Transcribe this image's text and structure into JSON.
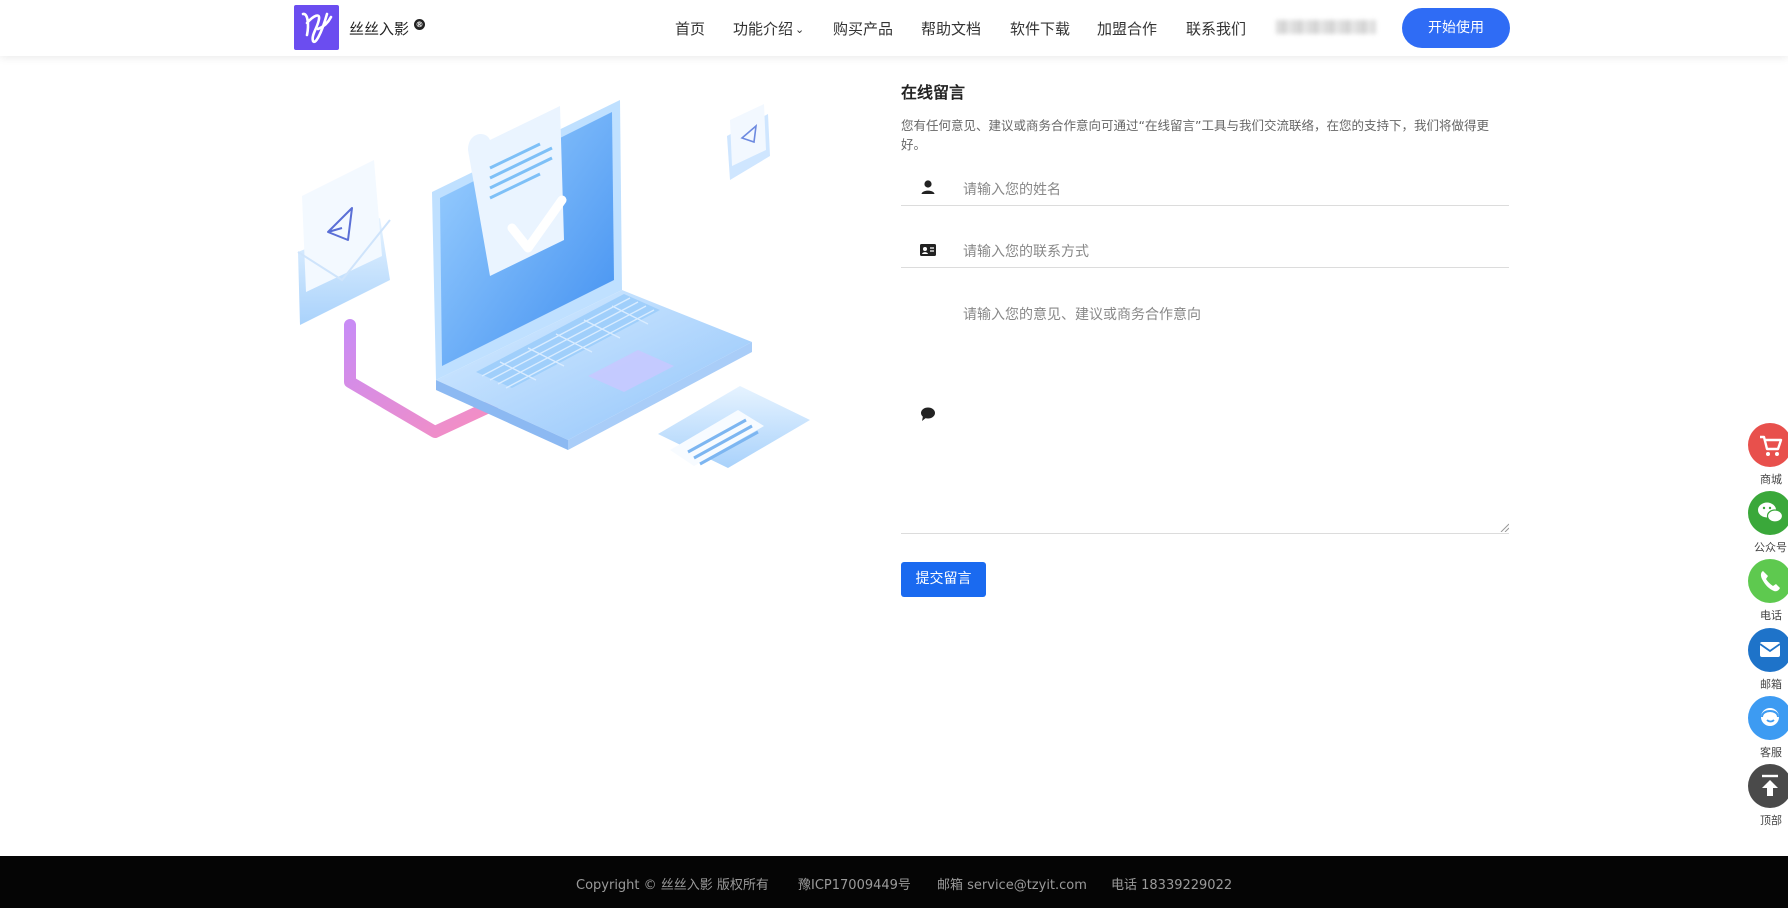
{
  "header": {
    "brand": "丝丝入影",
    "brand_badge": "®",
    "start_label": "开始使用"
  },
  "nav": [
    {
      "label": "首页"
    },
    {
      "label": "功能介绍"
    },
    {
      "label": "购买产品"
    },
    {
      "label": "帮助文档"
    },
    {
      "label": "软件下载"
    },
    {
      "label": "加盟合作"
    },
    {
      "label": "联系我们"
    }
  ],
  "form": {
    "title": "在线留言",
    "description": "您有任何意见、建议或商务合作意向可通过“在线留言”工具与我们交流联络，在您的支持下，我们将做得更好。",
    "name_placeholder": "请输入您的姓名",
    "contact_placeholder": "请输入您的联系方式",
    "message_placeholder": "请输入您的意见、建议或商务合作意向",
    "submit_label": "提交留言"
  },
  "side": [
    {
      "label": "商城",
      "icon": "cart-icon",
      "color": "#e8504c"
    },
    {
      "label": "公众号",
      "icon": "wechat-icon",
      "color": "#3aa83a"
    },
    {
      "label": "电话",
      "icon": "phone-icon",
      "color": "#5ec94f"
    },
    {
      "label": "邮箱",
      "icon": "mail-icon",
      "color": "#1e73c9"
    },
    {
      "label": "客服",
      "icon": "customer-service-icon",
      "color": "#3d9bf2"
    },
    {
      "label": "顶部",
      "icon": "back-to-top-icon",
      "color": "#4a4a4a"
    }
  ],
  "footer": {
    "copyright": "Copyright © 丝丝入影 版权所有",
    "icp": "豫ICP17009449号",
    "email": "邮箱 service@tzyit.com",
    "phone": "电话 18339229022"
  },
  "colors": {
    "primary": "#2f6cf5",
    "submit": "#1a6af0",
    "logo": "#6b4df0",
    "footer_bg": "#050505"
  }
}
